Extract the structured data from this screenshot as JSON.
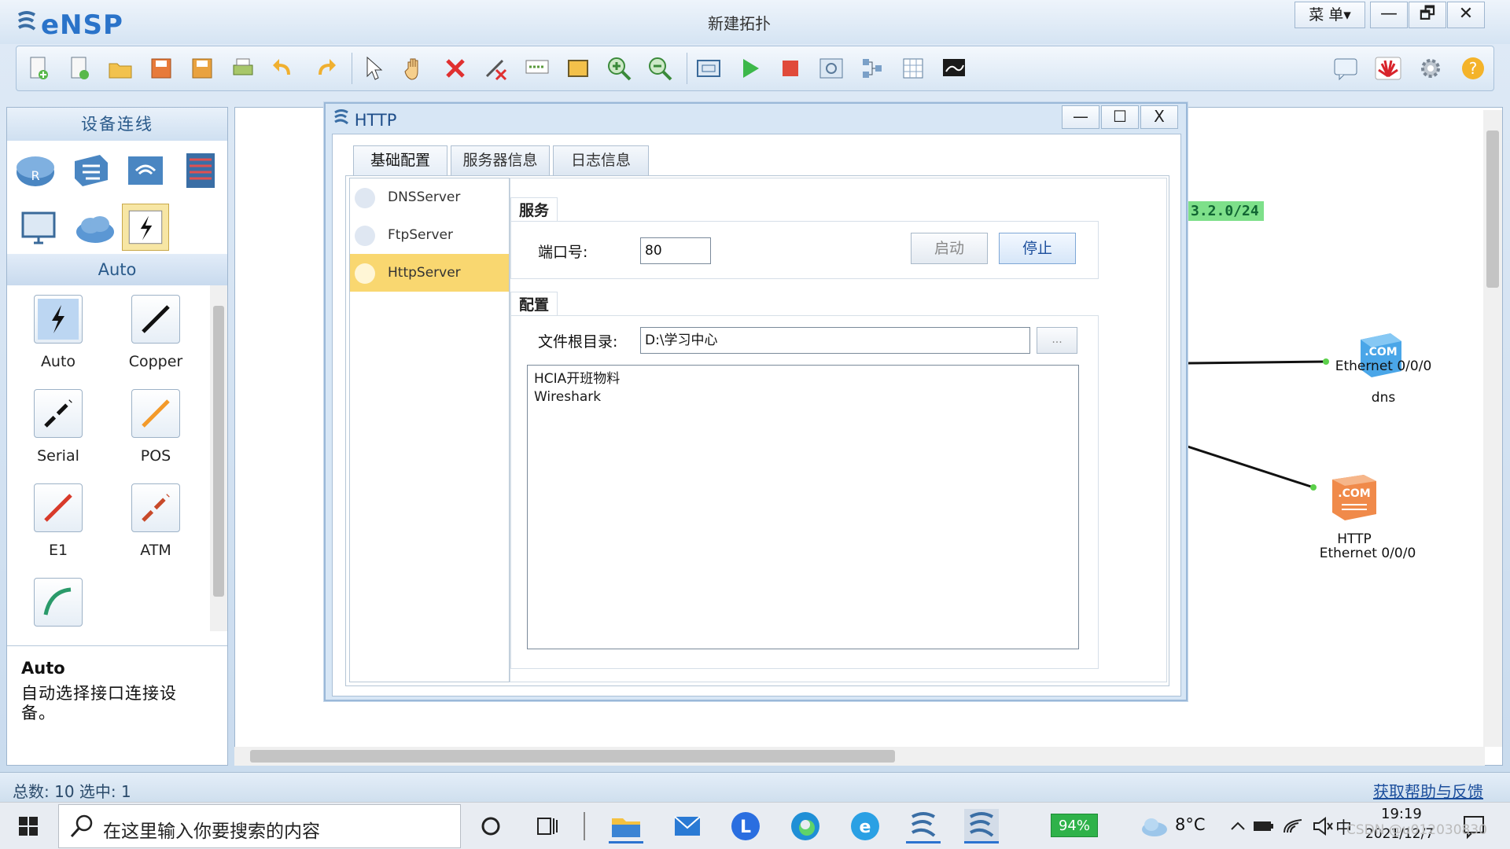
{
  "app": {
    "logo": "eNSP",
    "title": "新建拓扑",
    "menu_label": "菜 单▾",
    "minimize": "—",
    "restore": "🗗",
    "close": "✕"
  },
  "toolbar": {
    "icons": [
      "new-topology-icon",
      "new-file-icon",
      "open-icon",
      "save-icon",
      "save-as-icon",
      "print-icon",
      "undo-icon",
      "redo-icon",
      "select-icon",
      "pan-hand-icon",
      "delete-icon",
      "delete-link-icon",
      "text-icon",
      "rectangle-icon",
      "zoom-in-icon",
      "zoom-out-icon",
      "fit-icon",
      "start-device-icon",
      "stop-device-icon",
      "capture-icon",
      "topology-icon",
      "grid-icon",
      "console-icon"
    ],
    "right_icons": [
      "chat-icon",
      "huawei-icon",
      "settings-icon",
      "help-icon"
    ]
  },
  "left_panel": {
    "header": "设备连线",
    "category": "Auto",
    "cables": [
      {
        "label": "Auto"
      },
      {
        "label": "Copper"
      },
      {
        "label": "Serial"
      },
      {
        "label": "POS"
      },
      {
        "label": "E1"
      },
      {
        "label": "ATM"
      },
      {
        "label": ""
      }
    ],
    "description_title": "Auto",
    "description_text": "自动选择接口连接设备。"
  },
  "canvas": {
    "subnet_label": "3.2.0/24",
    "devices": [
      {
        "name": "dns",
        "port": "Ethernet 0/0/0"
      },
      {
        "name": "HTTP",
        "port": "Ethernet 0/0/0"
      }
    ]
  },
  "status": {
    "text": "总数: 10  选中: 1",
    "help_link": "获取帮助与反馈"
  },
  "dialog": {
    "title": "HTTP",
    "minimize": "—",
    "maximize": "☐",
    "close": "X",
    "tabs": [
      "基础配置",
      "服务器信息",
      "日志信息"
    ],
    "servers": [
      "DNSServer",
      "FtpServer",
      "HttpServer"
    ],
    "service_group": "服务",
    "port_label": "端口号:",
    "port_value": "80",
    "start_button": "启动",
    "stop_button": "停止",
    "config_group": "配置",
    "root_label": "文件根目录:",
    "root_value": "D:\\学习中心",
    "browse_button": "...",
    "files": [
      "HCIA开班物料",
      "Wireshark"
    ]
  },
  "taskbar": {
    "search_placeholder": "在这里输入你要搜索的内容",
    "battery": "94%",
    "temperature": "8°C",
    "ime": "中",
    "time": "19:19",
    "date": "2021/12/7",
    "watermark": "CSDN @u012030830"
  }
}
